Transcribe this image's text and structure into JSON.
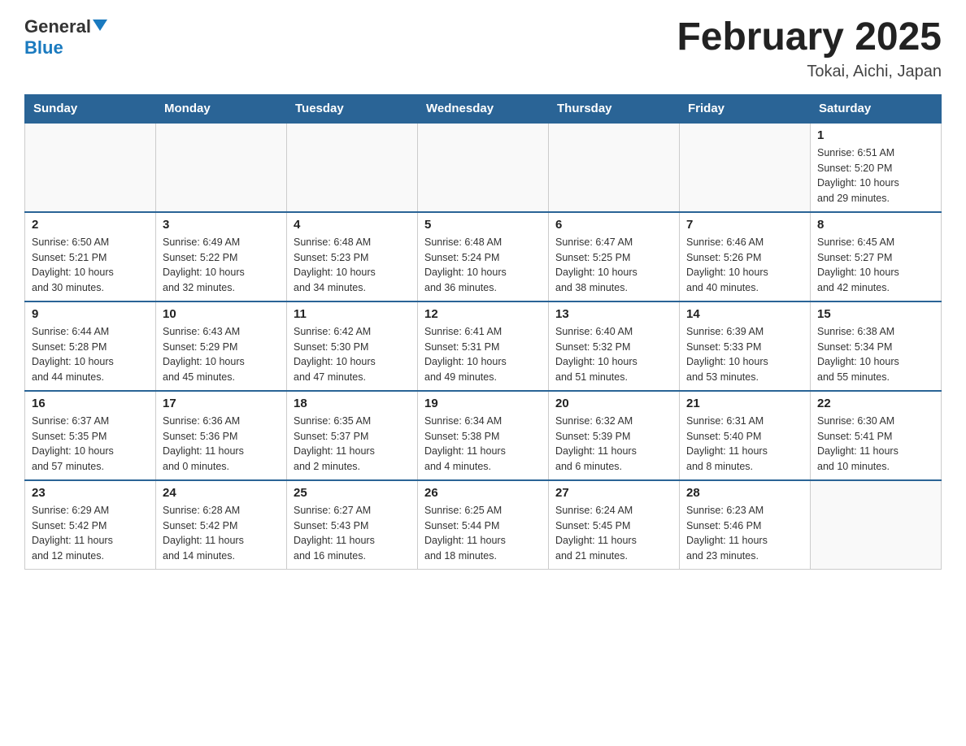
{
  "header": {
    "logo_general": "General",
    "logo_blue": "Blue",
    "title": "February 2025",
    "location": "Tokai, Aichi, Japan"
  },
  "weekdays": [
    "Sunday",
    "Monday",
    "Tuesday",
    "Wednesday",
    "Thursday",
    "Friday",
    "Saturday"
  ],
  "weeks": [
    [
      {
        "day": "",
        "info": ""
      },
      {
        "day": "",
        "info": ""
      },
      {
        "day": "",
        "info": ""
      },
      {
        "day": "",
        "info": ""
      },
      {
        "day": "",
        "info": ""
      },
      {
        "day": "",
        "info": ""
      },
      {
        "day": "1",
        "info": "Sunrise: 6:51 AM\nSunset: 5:20 PM\nDaylight: 10 hours\nand 29 minutes."
      }
    ],
    [
      {
        "day": "2",
        "info": "Sunrise: 6:50 AM\nSunset: 5:21 PM\nDaylight: 10 hours\nand 30 minutes."
      },
      {
        "day": "3",
        "info": "Sunrise: 6:49 AM\nSunset: 5:22 PM\nDaylight: 10 hours\nand 32 minutes."
      },
      {
        "day": "4",
        "info": "Sunrise: 6:48 AM\nSunset: 5:23 PM\nDaylight: 10 hours\nand 34 minutes."
      },
      {
        "day": "5",
        "info": "Sunrise: 6:48 AM\nSunset: 5:24 PM\nDaylight: 10 hours\nand 36 minutes."
      },
      {
        "day": "6",
        "info": "Sunrise: 6:47 AM\nSunset: 5:25 PM\nDaylight: 10 hours\nand 38 minutes."
      },
      {
        "day": "7",
        "info": "Sunrise: 6:46 AM\nSunset: 5:26 PM\nDaylight: 10 hours\nand 40 minutes."
      },
      {
        "day": "8",
        "info": "Sunrise: 6:45 AM\nSunset: 5:27 PM\nDaylight: 10 hours\nand 42 minutes."
      }
    ],
    [
      {
        "day": "9",
        "info": "Sunrise: 6:44 AM\nSunset: 5:28 PM\nDaylight: 10 hours\nand 44 minutes."
      },
      {
        "day": "10",
        "info": "Sunrise: 6:43 AM\nSunset: 5:29 PM\nDaylight: 10 hours\nand 45 minutes."
      },
      {
        "day": "11",
        "info": "Sunrise: 6:42 AM\nSunset: 5:30 PM\nDaylight: 10 hours\nand 47 minutes."
      },
      {
        "day": "12",
        "info": "Sunrise: 6:41 AM\nSunset: 5:31 PM\nDaylight: 10 hours\nand 49 minutes."
      },
      {
        "day": "13",
        "info": "Sunrise: 6:40 AM\nSunset: 5:32 PM\nDaylight: 10 hours\nand 51 minutes."
      },
      {
        "day": "14",
        "info": "Sunrise: 6:39 AM\nSunset: 5:33 PM\nDaylight: 10 hours\nand 53 minutes."
      },
      {
        "day": "15",
        "info": "Sunrise: 6:38 AM\nSunset: 5:34 PM\nDaylight: 10 hours\nand 55 minutes."
      }
    ],
    [
      {
        "day": "16",
        "info": "Sunrise: 6:37 AM\nSunset: 5:35 PM\nDaylight: 10 hours\nand 57 minutes."
      },
      {
        "day": "17",
        "info": "Sunrise: 6:36 AM\nSunset: 5:36 PM\nDaylight: 11 hours\nand 0 minutes."
      },
      {
        "day": "18",
        "info": "Sunrise: 6:35 AM\nSunset: 5:37 PM\nDaylight: 11 hours\nand 2 minutes."
      },
      {
        "day": "19",
        "info": "Sunrise: 6:34 AM\nSunset: 5:38 PM\nDaylight: 11 hours\nand 4 minutes."
      },
      {
        "day": "20",
        "info": "Sunrise: 6:32 AM\nSunset: 5:39 PM\nDaylight: 11 hours\nand 6 minutes."
      },
      {
        "day": "21",
        "info": "Sunrise: 6:31 AM\nSunset: 5:40 PM\nDaylight: 11 hours\nand 8 minutes."
      },
      {
        "day": "22",
        "info": "Sunrise: 6:30 AM\nSunset: 5:41 PM\nDaylight: 11 hours\nand 10 minutes."
      }
    ],
    [
      {
        "day": "23",
        "info": "Sunrise: 6:29 AM\nSunset: 5:42 PM\nDaylight: 11 hours\nand 12 minutes."
      },
      {
        "day": "24",
        "info": "Sunrise: 6:28 AM\nSunset: 5:42 PM\nDaylight: 11 hours\nand 14 minutes."
      },
      {
        "day": "25",
        "info": "Sunrise: 6:27 AM\nSunset: 5:43 PM\nDaylight: 11 hours\nand 16 minutes."
      },
      {
        "day": "26",
        "info": "Sunrise: 6:25 AM\nSunset: 5:44 PM\nDaylight: 11 hours\nand 18 minutes."
      },
      {
        "day": "27",
        "info": "Sunrise: 6:24 AM\nSunset: 5:45 PM\nDaylight: 11 hours\nand 21 minutes."
      },
      {
        "day": "28",
        "info": "Sunrise: 6:23 AM\nSunset: 5:46 PM\nDaylight: 11 hours\nand 23 minutes."
      },
      {
        "day": "",
        "info": ""
      }
    ]
  ]
}
